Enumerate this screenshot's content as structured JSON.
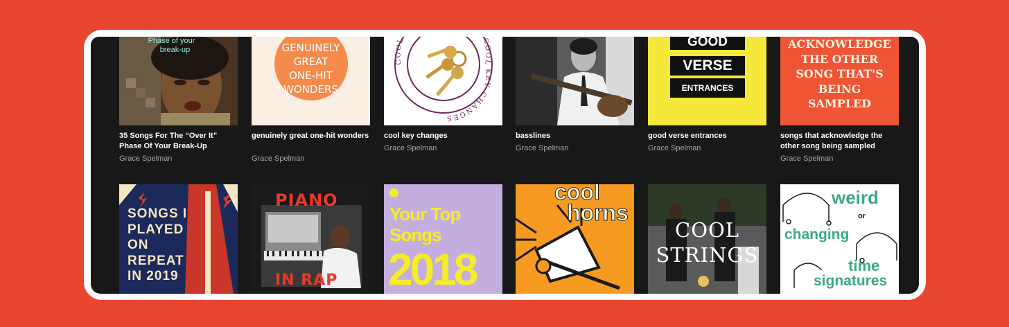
{
  "row1": [
    {
      "id": "breakup",
      "title": "35 Songs For The “Over It” Phase Of Your Break-Up",
      "author": "Grace Spelman",
      "art": [
        "Phase of your",
        "break-up"
      ]
    },
    {
      "id": "onehit",
      "title": "genuinely great one-hit wonders",
      "author": "Grace Spelman",
      "art": [
        "GENUINELY",
        "GREAT",
        "ONE-HIT",
        "WONDERS"
      ]
    },
    {
      "id": "keychanges",
      "title": "cool key changes",
      "author": "Grace Spelman",
      "art": [
        "COOL KEY CHANGES FOR COOL KEY CHANGES"
      ]
    },
    {
      "id": "basslines",
      "title": "basslines",
      "author": "Grace Spelman",
      "art": []
    },
    {
      "id": "verse",
      "title": "good verse entrances",
      "author": "Grace Spelman",
      "art": [
        "GOOD",
        "VERSE",
        "ENTRANCES"
      ]
    },
    {
      "id": "sampled",
      "title": "songs that acknowledge the other song being sampled",
      "author": "Grace Spelman",
      "art": [
        "ACKNOWLEDGE",
        "THE OTHER",
        "SONG THAT'S",
        "BEING",
        "SAMPLED"
      ]
    }
  ],
  "row2": [
    {
      "id": "repeat2019",
      "art": [
        "SONGS I",
        "PLAYED",
        "ON",
        "REPEAT",
        "IN 2019"
      ]
    },
    {
      "id": "pianorap",
      "art": [
        "PIANO",
        "IN RAP"
      ]
    },
    {
      "id": "top2018",
      "art": [
        "Your Top",
        "Songs",
        "2018"
      ]
    },
    {
      "id": "horns",
      "art": [
        "cool",
        "horns"
      ]
    },
    {
      "id": "strings",
      "art": [
        "COOL",
        "STRINGS"
      ]
    },
    {
      "id": "timesig",
      "art": [
        "weird",
        "or",
        "changing",
        "time",
        "signatures"
      ]
    }
  ],
  "colors": {
    "background": "#e8462f",
    "panel": "#181818",
    "title": "#ffffff",
    "author": "#a7a7a7"
  }
}
